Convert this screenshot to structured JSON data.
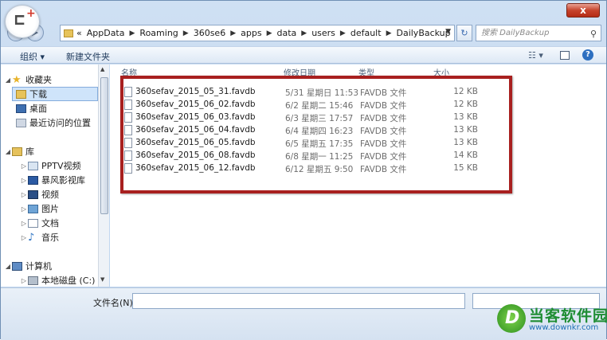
{
  "window": {
    "close_glyph": "x"
  },
  "address": {
    "prefix": "«",
    "crumbs": [
      "AppData",
      "Roaming",
      "360se6",
      "apps",
      "data",
      "users",
      "default",
      "DailyBackup"
    ],
    "search_placeholder": "搜索 DailyBackup"
  },
  "toolbar": {
    "organize_label": "组织 ▾",
    "new_folder_label": "新建文件夹"
  },
  "sidebar": {
    "items": [
      {
        "label": "收藏夹",
        "icon": "star-icon"
      },
      {
        "label": "下载",
        "icon": "download-folder-icon"
      },
      {
        "label": "桌面",
        "icon": "desktop-icon"
      },
      {
        "label": "最近访问的位置",
        "icon": "recent-places-icon"
      },
      {
        "label": "库",
        "icon": "library-icon"
      },
      {
        "label": "PPTV视频",
        "icon": "pptv-library-icon"
      },
      {
        "label": "暴风影视库",
        "icon": "baofeng-library-icon"
      },
      {
        "label": "视频",
        "icon": "video-library-icon"
      },
      {
        "label": "图片",
        "icon": "pictures-library-icon"
      },
      {
        "label": "文档",
        "icon": "documents-library-icon"
      },
      {
        "label": "音乐",
        "icon": "music-library-icon"
      },
      {
        "label": "计算机",
        "icon": "computer-icon"
      },
      {
        "label": "本地磁盘 (C:)",
        "icon": "local-disk-icon"
      }
    ]
  },
  "columns": {
    "name": "名称",
    "date": "修改日期",
    "type": "类型",
    "size": "大小"
  },
  "files": [
    {
      "name": "360sefav_2015_05_31.favdb",
      "date": "5/31 星期日 11:53",
      "type": "FAVDB 文件",
      "size": "12 KB"
    },
    {
      "name": "360sefav_2015_06_02.favdb",
      "date": "6/2 星期二 15:46",
      "type": "FAVDB 文件",
      "size": "12 KB"
    },
    {
      "name": "360sefav_2015_06_03.favdb",
      "date": "6/3 星期三 17:57",
      "type": "FAVDB 文件",
      "size": "13 KB"
    },
    {
      "name": "360sefav_2015_06_04.favdb",
      "date": "6/4 星期四 16:23",
      "type": "FAVDB 文件",
      "size": "13 KB"
    },
    {
      "name": "360sefav_2015_06_05.favdb",
      "date": "6/5 星期五 17:35",
      "type": "FAVDB 文件",
      "size": "13 KB"
    },
    {
      "name": "360sefav_2015_06_08.favdb",
      "date": "6/8 星期一 11:25",
      "type": "FAVDB 文件",
      "size": "14 KB"
    },
    {
      "name": "360sefav_2015_06_12.favdb",
      "date": "6/12 星期五 9:50",
      "type": "FAVDB 文件",
      "size": "15 KB"
    }
  ],
  "bottom": {
    "filename_label": "文件名(N):",
    "filename_value": ""
  },
  "watermark": {
    "title": "当客软件园",
    "url": "www.downkr.com"
  },
  "colors": {
    "highlight": "#a8201f",
    "selection": "#cfe4fa"
  }
}
